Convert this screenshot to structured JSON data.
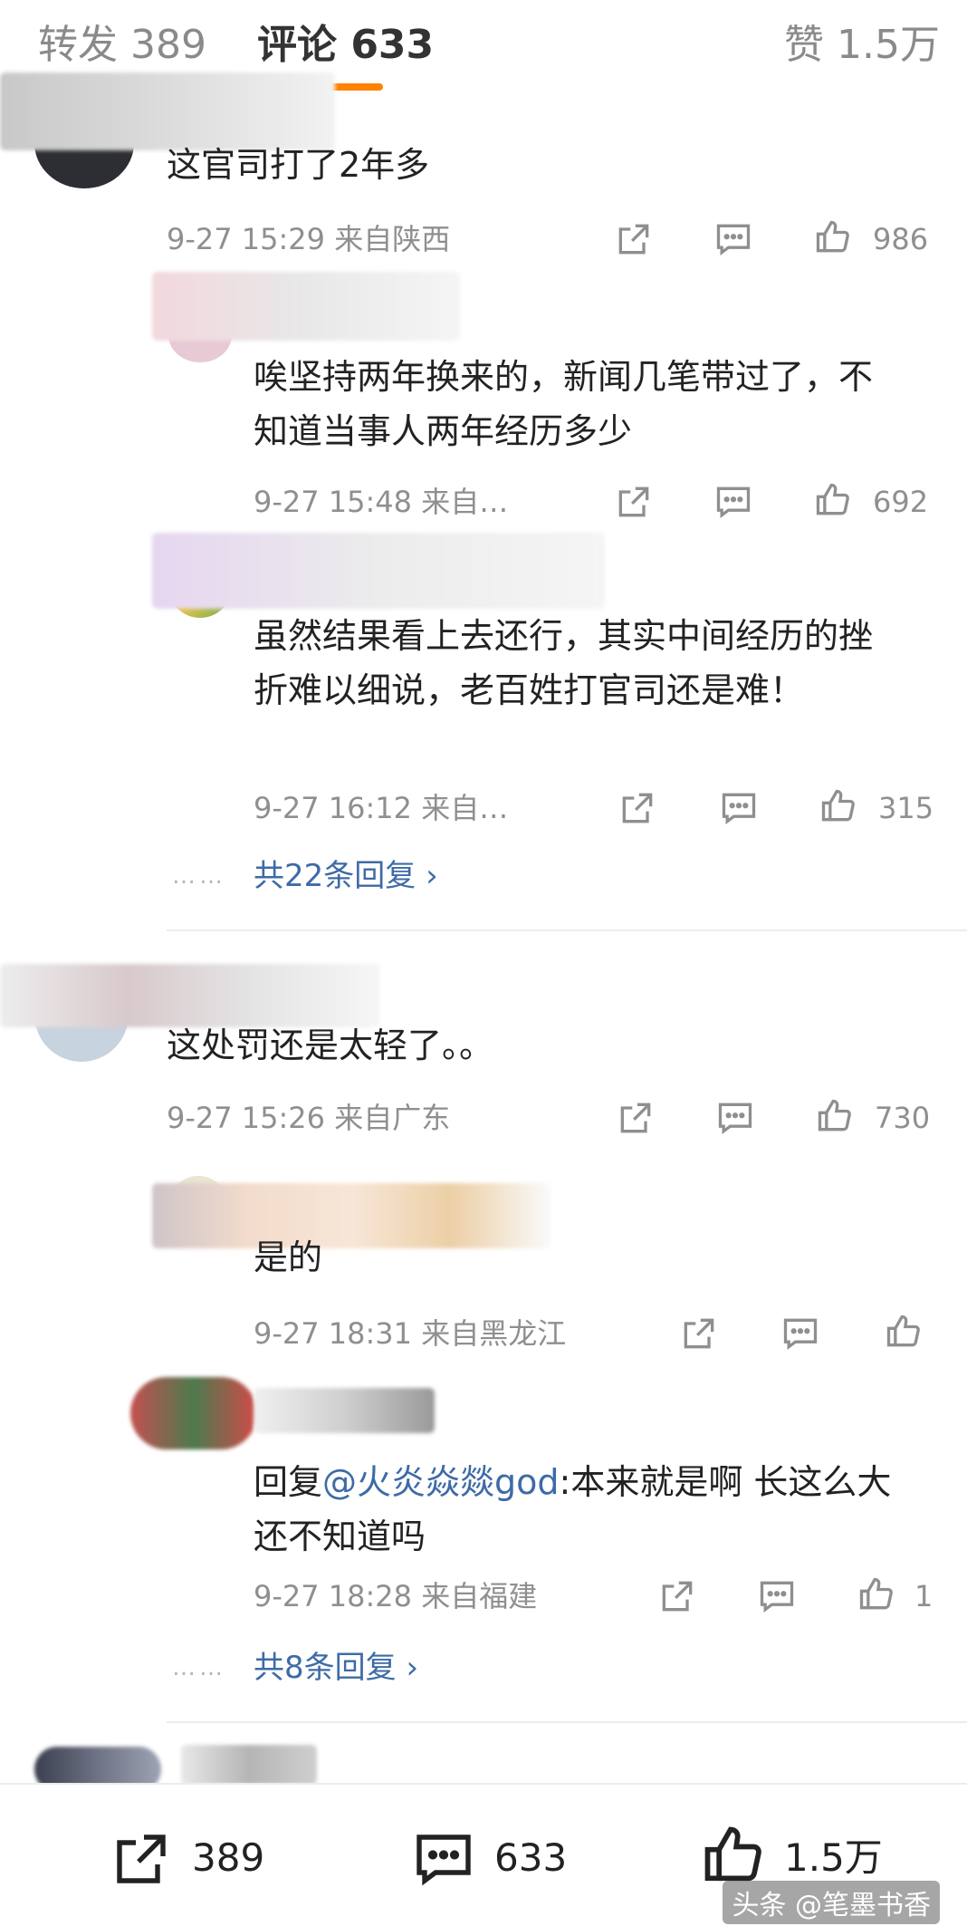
{
  "tabs": {
    "repost": "转发 389",
    "comment": "评论 633",
    "like": "赞 1.5万"
  },
  "comments": [
    {
      "text": "这官司打了2年多",
      "meta": "9-27 15:29 来自陕西",
      "likes": "986"
    },
    {
      "text": "唉坚持两年换来的，新闻几笔带过了，不知道当事人两年经历多少",
      "meta": "9-27 15:48 来自…",
      "likes": "692"
    },
    {
      "text": "虽然结果看上去还行，其实中间经历的挫折难以细说，老百姓打官司还是难！",
      "meta": "9-27 16:12 来自…",
      "likes": "315"
    },
    {
      "more": "共22条回复 ›"
    },
    {
      "text": "这处罚还是太轻了。。",
      "meta": "9-27 15:26 来自广东",
      "likes": "730"
    },
    {
      "text": "是的",
      "meta": "9-27 18:31 来自黑龙江",
      "likes": ""
    },
    {
      "reply_prefix": "回复",
      "mention": "@火炎焱燚god",
      "reply_rest": ":本来就是啊 长这么大还不知道吗",
      "meta": "9-27 18:28 来自福建",
      "likes": "1"
    },
    {
      "more": "共8条回复 ›"
    }
  ],
  "bottom": {
    "repost": "389",
    "comment": "633",
    "like": "1.5万"
  },
  "watermark": "头条 @笔墨书香"
}
